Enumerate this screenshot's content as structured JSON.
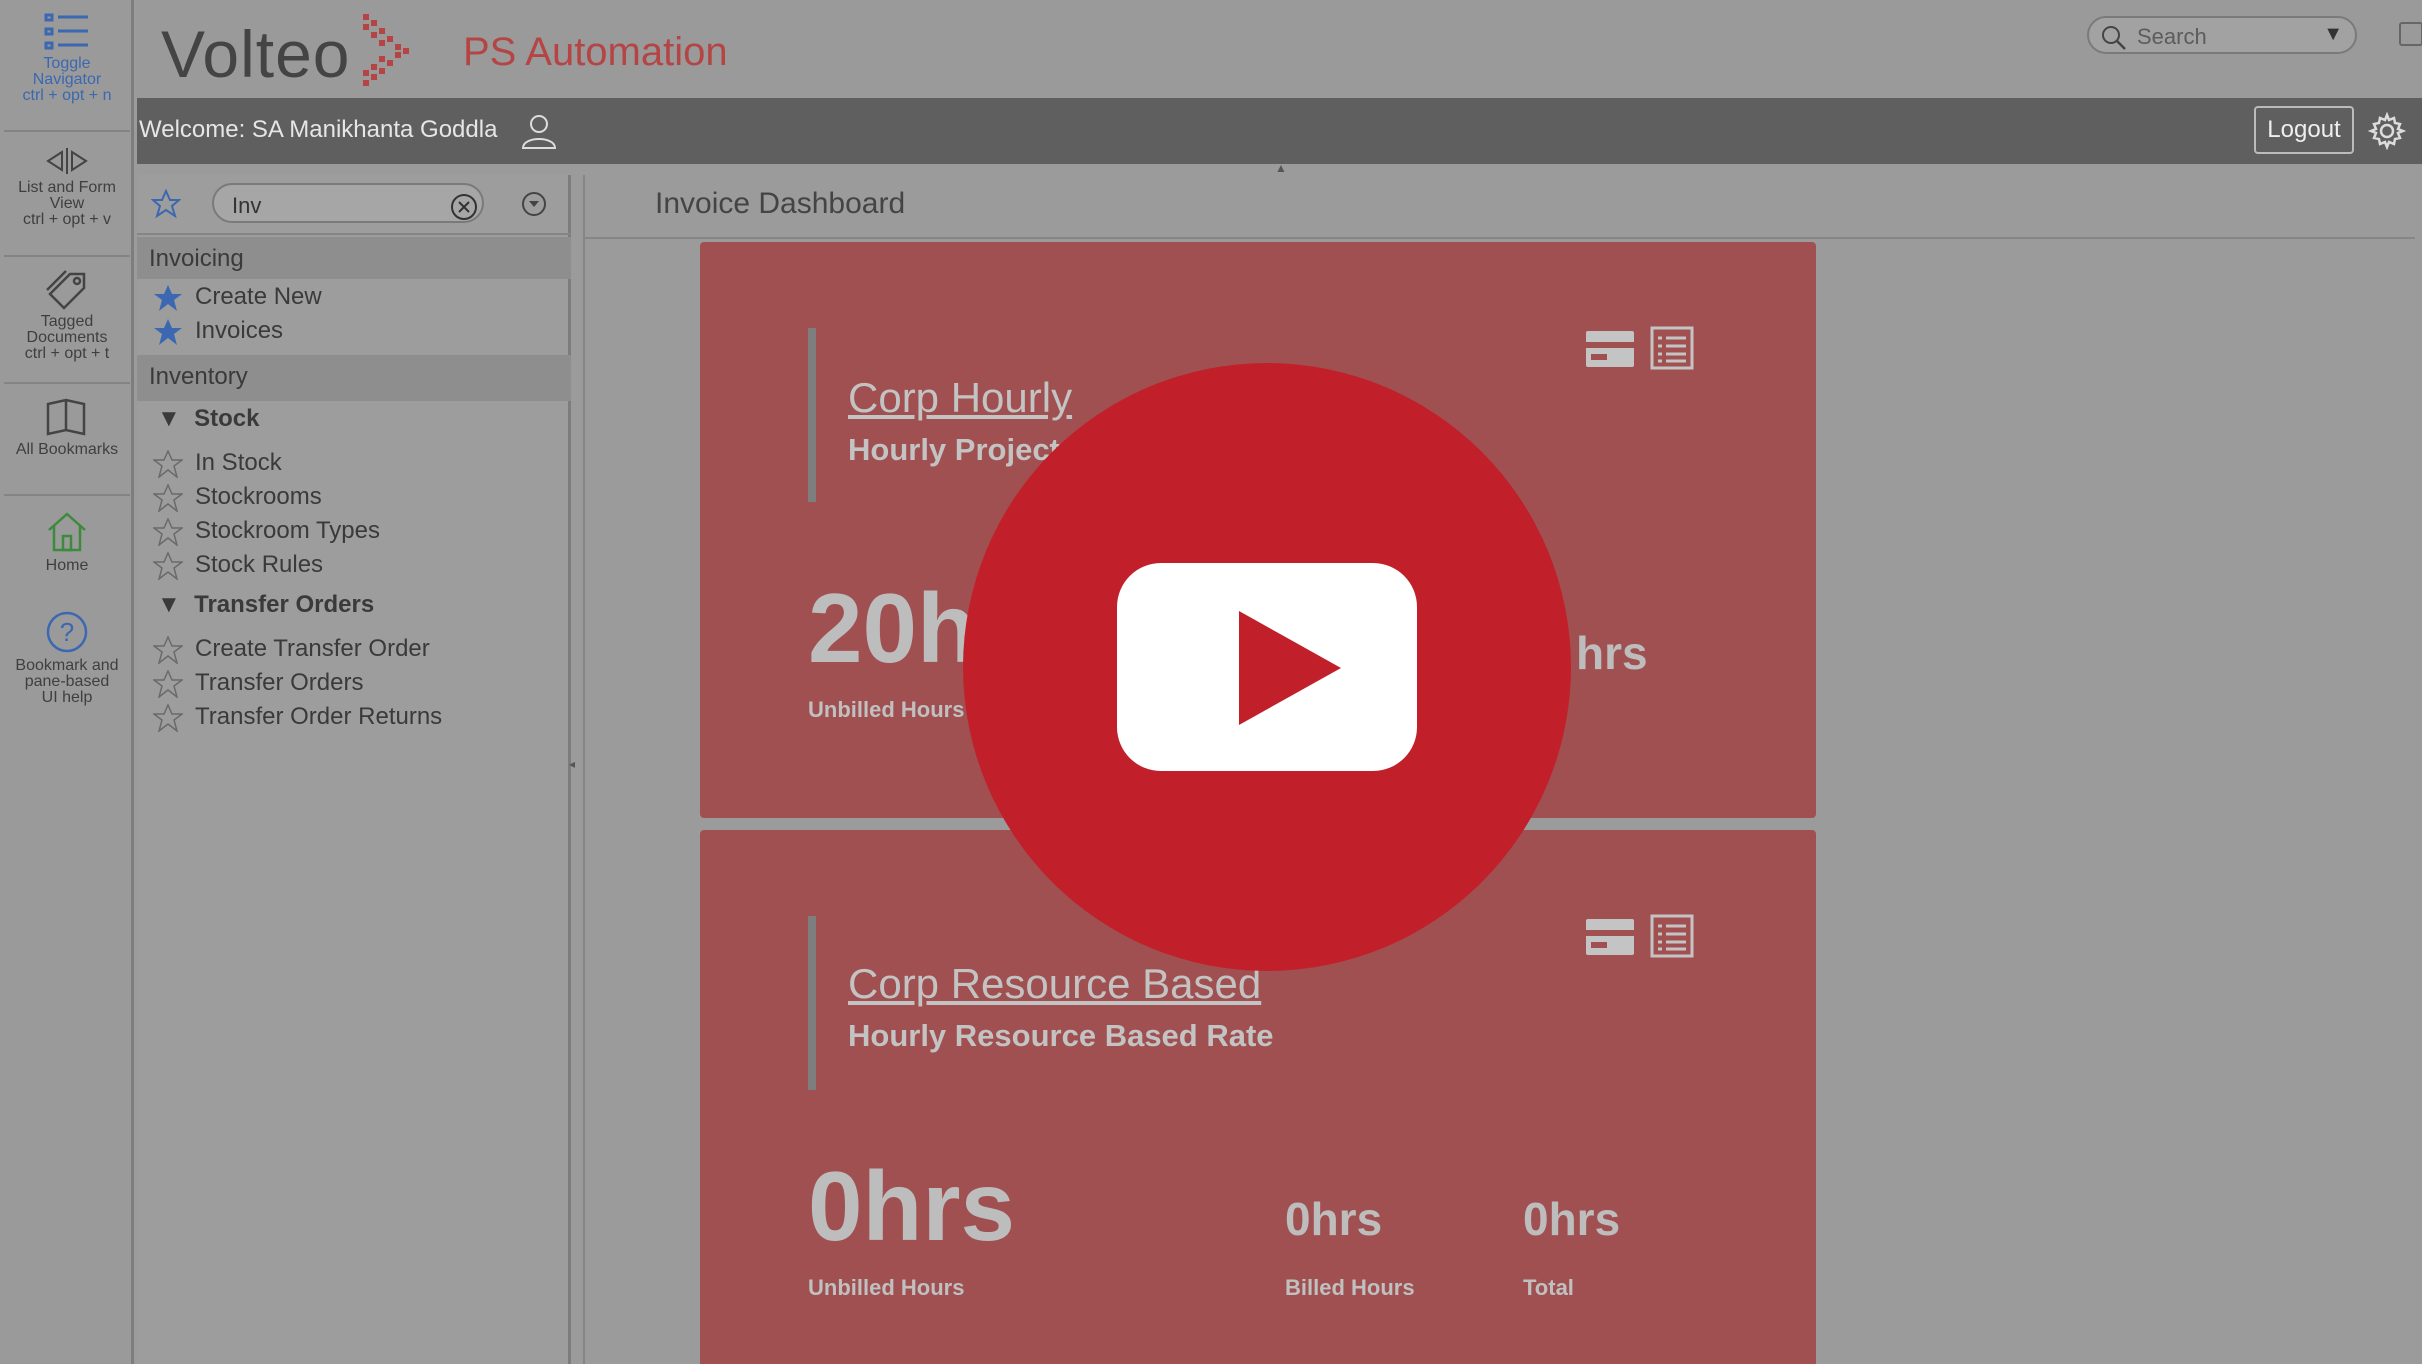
{
  "rail": {
    "toggle_navigator": {
      "label_line1": "Toggle",
      "label_line2": "Navigator",
      "shortcut": "ctrl + opt + n"
    },
    "list_form_view": {
      "label_line1": "List and Form",
      "label_line2": "View",
      "shortcut": "ctrl + opt + v"
    },
    "tagged_documents": {
      "label_line1": "Tagged",
      "label_line2": "Documents",
      "shortcut": "ctrl + opt + t"
    },
    "all_bookmarks": {
      "label": "All Bookmarks"
    },
    "home": {
      "label": "Home"
    },
    "help": {
      "label_line1": "Bookmark and",
      "label_line2": "pane-based",
      "label_line3": "UI help"
    }
  },
  "header": {
    "logo": "Volteo",
    "app_title": "PS Automation",
    "search_placeholder": "Search"
  },
  "welcome_bar": {
    "welcome_text": "Welcome:  SA Manikhanta Goddla",
    "logout_label": "Logout"
  },
  "navigator": {
    "search_value": "Inv",
    "sections": [
      {
        "label": "Invoicing",
        "items": [
          "Create New",
          "Invoices"
        ]
      },
      {
        "label": "Inventory"
      }
    ],
    "groups": [
      {
        "label": "Stock",
        "items": [
          "In Stock",
          "Stockrooms",
          "Stockroom Types",
          "Stock Rules"
        ]
      },
      {
        "label": "Transfer Orders",
        "items": [
          "Create Transfer Order",
          "Transfer Orders",
          "Transfer Order Returns"
        ]
      }
    ]
  },
  "content": {
    "title": "Invoice Dashboard",
    "cards": [
      {
        "title": "Corp Hourly",
        "subtitle": "Hourly Project",
        "unbilled_value": "20h",
        "unbilled_label": "Unbilled Hours",
        "partial_value": "hrs"
      },
      {
        "title": "Corp Resource Based",
        "subtitle": "Hourly Resource Based Rate",
        "unbilled_value": "0hrs",
        "unbilled_label": "Unbilled Hours",
        "billed_value": "0hrs",
        "billed_label": "Billed Hours",
        "total_value": "0hrs",
        "total_label": "Total"
      }
    ]
  },
  "colors": {
    "card_bg": "#a05050",
    "play_red": "#c1202b",
    "accent_title": "#b54545",
    "star_blue": "#3b68b1"
  }
}
